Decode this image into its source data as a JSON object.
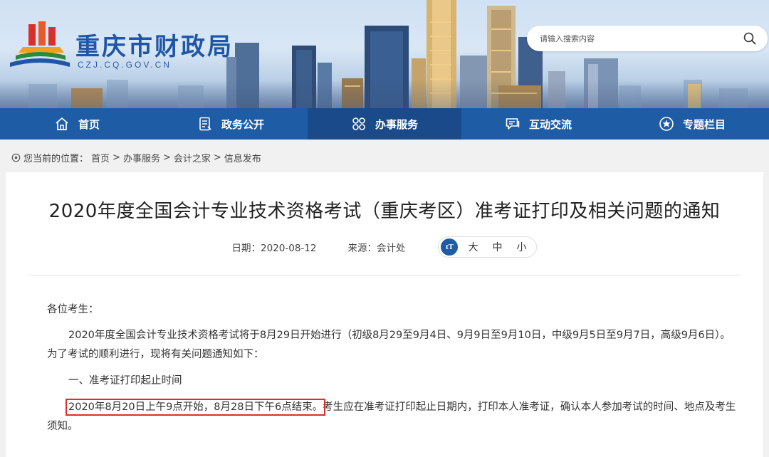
{
  "header": {
    "site_title": "重庆市财政局",
    "site_url": "CZJ.CQ.GOV.CN",
    "search_placeholder": "请输入搜索内容",
    "colors": {
      "nav": "#1f5ca6",
      "nav_active": "#1a4a8a",
      "title": "#1f56a8",
      "highlight": "#d9302c"
    }
  },
  "nav": [
    {
      "label": "首页",
      "icon": "home-icon"
    },
    {
      "label": "政务公开",
      "icon": "document-icon"
    },
    {
      "label": "办事服务",
      "icon": "grid-icon",
      "active": true
    },
    {
      "label": "互动交流",
      "icon": "chat-icon"
    },
    {
      "label": "专题栏目",
      "icon": "star-icon"
    }
  ],
  "breadcrumb": {
    "prefix": "您当前的位置：",
    "items": [
      "首页",
      "办事服务",
      "会计之家",
      "信息发布"
    ],
    "separator": ">"
  },
  "article": {
    "title": "2020年度全国会计专业技术资格考试（重庆考区）准考证打印及相关问题的通知",
    "date": "日期：2020-08-12",
    "source": "来源：会计处",
    "font_sizes": [
      "大",
      "中",
      "小"
    ],
    "greeting": "各位考生：",
    "para1_line1": "2020年度全国会计专业技术资格考试将于8月29日开始进行（初级8月29至9月4日、9月9日至9月10日，中级9月5日至9月7日，高级9月6日）。",
    "para1_line2": "为了考试的顺利进行，现将有关问题通知如下：",
    "section1": "一、准考证打印起止时间",
    "para2_highlight": "2020年8月20日上午9点开始，8月28日下午6点结束。",
    "para2_rest": "考生应在准考证打印起止日期内，打印本人准考证，确认本人参加考试的时间、地点及考生",
    "para2_line2": "须知。"
  }
}
